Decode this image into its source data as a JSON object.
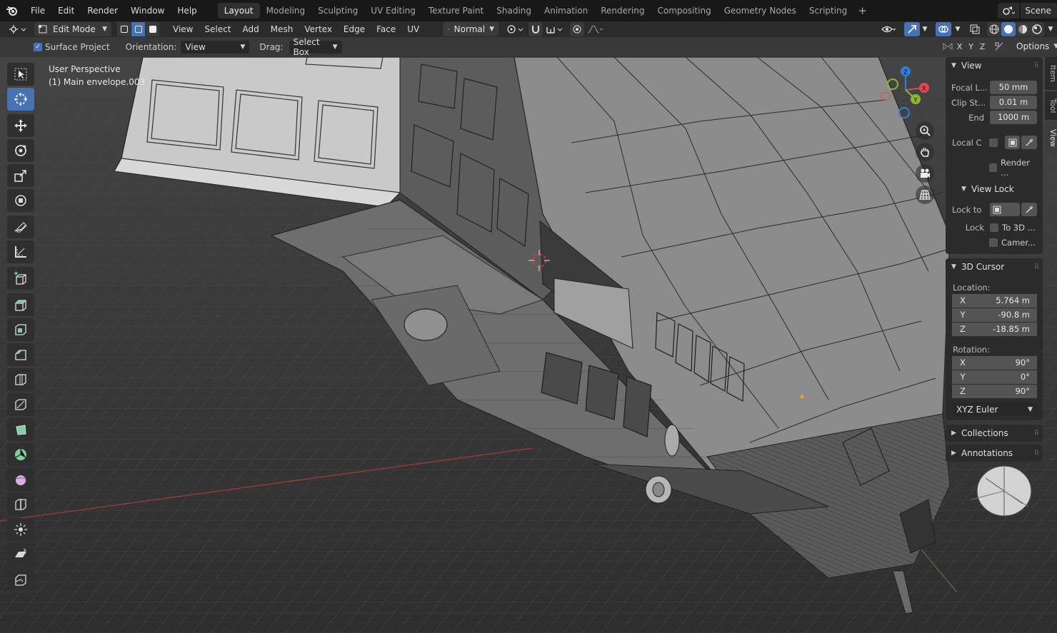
{
  "topbar": {
    "menus": [
      "File",
      "Edit",
      "Render",
      "Window",
      "Help"
    ],
    "workspaces": [
      "Layout",
      "Modeling",
      "Sculpting",
      "UV Editing",
      "Texture Paint",
      "Shading",
      "Animation",
      "Rendering",
      "Compositing",
      "Geometry Nodes",
      "Scripting"
    ],
    "active_workspace": "Layout",
    "add_tab": "+",
    "scene_name": "Scene"
  },
  "header": {
    "mode": "Edit Mode",
    "menus": [
      "View",
      "Select",
      "Add",
      "Mesh",
      "Vertex",
      "Edge",
      "Face",
      "UV"
    ],
    "transform_orientation": "Normal"
  },
  "toolsettings": {
    "surface_project_label": "Surface Project",
    "surface_project_checked": true,
    "orientation_label": "Orientation:",
    "orientation_value": "View",
    "drag_label": "Drag:",
    "drag_value": "Select Box",
    "axis_x": "X",
    "axis_y": "Y",
    "axis_z": "Z",
    "options_label": "Options"
  },
  "viewport": {
    "perspective_label": "User Perspective",
    "object_label": "(1) Main envelope.003"
  },
  "gizmo": {
    "x": "X",
    "y": "Y",
    "z": "Z"
  },
  "sidebar": {
    "tabs": [
      "Item",
      "Tool",
      "View"
    ],
    "active_tab": "View",
    "view_panel": {
      "title": "View",
      "focal_label": "Focal L...",
      "focal_value": "50 mm",
      "clip_start_label": "Clip St...",
      "clip_start_value": "0.01 m",
      "clip_end_label": "End",
      "clip_end_value": "1000 m",
      "local_camera_label": "Local C",
      "render_region_label": "Render ...",
      "view_lock_title": "View Lock",
      "lock_to_label": "Lock to",
      "lock_label": "Lock",
      "to_3d_cursor_label": "To 3D ...",
      "camera_to_view_label": "Camer..."
    },
    "cursor_panel": {
      "title": "3D Cursor",
      "location_label": "Location:",
      "location": [
        {
          "axis": "X",
          "value": "5.764 m"
        },
        {
          "axis": "Y",
          "value": "-90.8 m"
        },
        {
          "axis": "Z",
          "value": "-18.85 m"
        }
      ],
      "rotation_label": "Rotation:",
      "rotation": [
        {
          "axis": "X",
          "value": "90°"
        },
        {
          "axis": "Y",
          "value": "0°"
        },
        {
          "axis": "Z",
          "value": "90°"
        }
      ],
      "rotation_mode": "XYZ Euler"
    },
    "collections_title": "Collections",
    "annotations_title": "Annotations"
  },
  "colors": {
    "accent": "#4772b3",
    "axis_x": "#e04852",
    "axis_y": "#8ab833",
    "axis_z": "#2f7ed8"
  },
  "icons": [
    "blender-logo-icon",
    "scene-icon",
    "select-icon",
    "cursor-icon",
    "move-icon",
    "rotate-icon",
    "scale-icon",
    "transform-icon",
    "annotate-icon",
    "measure-icon",
    "add-cube-icon",
    "extrude-icon",
    "inset-icon",
    "bevel-icon",
    "loop-cut-icon",
    "knife-icon",
    "poly-build-icon",
    "spin-icon",
    "smooth-icon",
    "edge-slide-icon",
    "shrink-fatten-icon",
    "shear-icon",
    "rip-icon",
    "zoom-icon",
    "hand-icon",
    "camera-icon",
    "grid-icon",
    "eyedropper-icon"
  ]
}
